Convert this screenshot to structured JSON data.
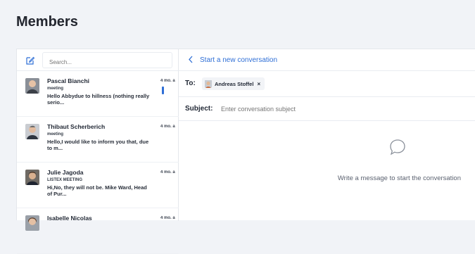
{
  "page": {
    "title": "Members"
  },
  "search": {
    "placeholder": "Search..."
  },
  "conversations": [
    {
      "name": "Pascal Bianchi",
      "subject": "meeting",
      "preview": "Hello Abbydue to hillness (nothing really serio...",
      "time": "4 mo. a",
      "unread": true
    },
    {
      "name": "Thibaut Scherberich",
      "subject": "meeting",
      "preview": "Hello,I would like to inform you that, due to m...",
      "time": "4 mo. a",
      "unread": false
    },
    {
      "name": "Julie Jagoda",
      "subject": "LISTEX MEETING",
      "preview": "Hi,No, they will not be. Mike Ward, Head of Pur...",
      "time": "4 mo. a",
      "unread": false
    },
    {
      "name": "Isabelle Nicolas",
      "subject": "",
      "preview": "",
      "time": "4 mo. a",
      "unread": false
    }
  ],
  "compose": {
    "back_label": "Start a new conversation",
    "to_label": "To:",
    "recipient": "Andreas Stoffel",
    "remove_symbol": "×",
    "subject_label": "Subject:",
    "subject_placeholder": "Enter conversation subject",
    "empty_message": "Write a message to start the conversation"
  },
  "icons": {
    "compose": "compose-icon",
    "back": "chevron-left-icon",
    "empty": "chat-bubble-icon"
  },
  "colors": {
    "accent": "#2f6fd6",
    "background": "#f1f3f7",
    "panel": "#ffffff"
  }
}
